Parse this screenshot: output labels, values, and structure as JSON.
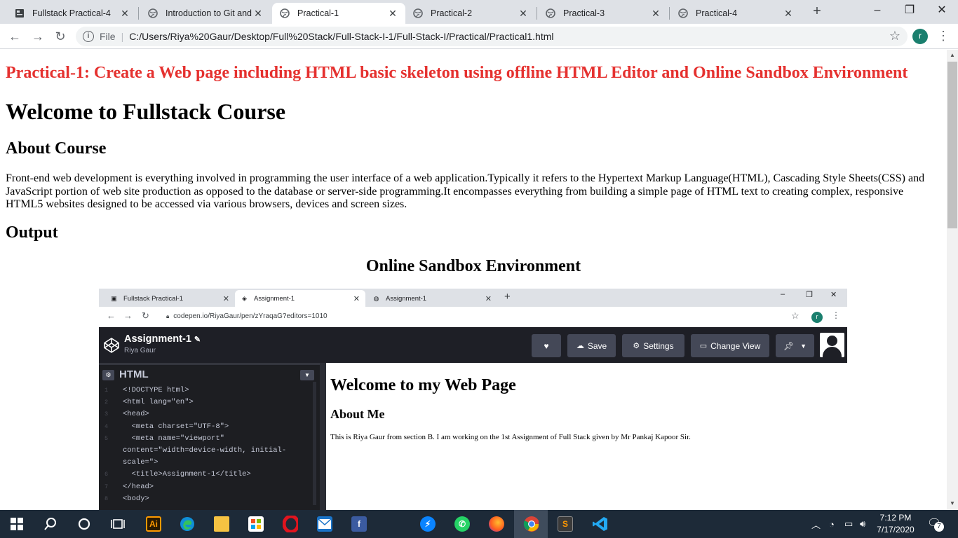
{
  "browser": {
    "tabs": [
      {
        "title": "Fullstack Practical-4",
        "icon": "page-icon"
      },
      {
        "title": "Introduction to Git and",
        "icon": "globe-icon"
      },
      {
        "title": "Practical-1",
        "icon": "globe-icon",
        "active": true
      },
      {
        "title": "Practical-2",
        "icon": "globe-icon"
      },
      {
        "title": "Practical-3",
        "icon": "globe-icon"
      },
      {
        "title": "Practical-4",
        "icon": "globe-icon"
      }
    ],
    "address": {
      "scheme_label": "File",
      "url": "C:/Users/Riya%20Gaur/Desktop/Full%20Stack/Full-Stack-I-1/Full-Stack-I/Practical/Practical1.html"
    },
    "profile_initial": "r"
  },
  "page": {
    "practical_title": "Practical-1: Create a Web page including HTML basic skeleton using offline HTML Editor and Online Sandbox Environment",
    "welcome_heading": "Welcome to Fullstack Course",
    "about_heading": "About Course",
    "about_text": "Front-end web development is everything involved in programming the user interface of a web application.Typically it refers to the Hypertext Markup Language(HTML), Cascading Style Sheets(CSS) and JavaScript portion of web site production as opposed to the database or server-side programming.It encompasses everything from building a simple page of HTML text to creating complex, responsive HTML5 websites designed to be accessed via various browsers, devices and screen sizes.",
    "output_heading": "Output",
    "sandbox_heading": "Online Sandbox Environment"
  },
  "screenshot": {
    "tabs": [
      {
        "title": "Fullstack Practical-1"
      },
      {
        "title": "Assignment-1",
        "active": true
      },
      {
        "title": "Assignment-1"
      }
    ],
    "url": "codepen.io/RiyaGaur/pen/zYraqaG?editors=1010",
    "profile_initial": "r",
    "codepen": {
      "pen_title": "Assignment-1",
      "author": "Riya Gaur",
      "buttons": {
        "save": "Save",
        "settings": "Settings",
        "change_view": "Change View"
      },
      "editor_label": "HTML",
      "code_lines": [
        {
          "n": "1",
          "text": "<!DOCTYPE html>"
        },
        {
          "n": "2",
          "text": "<html lang=\"en\">"
        },
        {
          "n": "3",
          "text": "<head>"
        },
        {
          "n": "4",
          "text": "  <meta charset=\"UTF-8\">"
        },
        {
          "n": "5",
          "text": "  <meta name=\"viewport\""
        },
        {
          "n": "",
          "text": "content=\"width=device-width, initial-"
        },
        {
          "n": "",
          "text": "scale=\">"
        },
        {
          "n": "6",
          "text": "  <title>Assignment-1</title>"
        },
        {
          "n": "7",
          "text": "</head>"
        },
        {
          "n": "8",
          "text": "<body>"
        }
      ],
      "preview": {
        "h1": "Welcome to my Web Page",
        "h2": "About Me",
        "p": "This is Riya Gaur from section B. I am working on the 1st Assignment of Full Stack given by Mr Pankaj Kapoor Sir."
      }
    }
  },
  "taskbar": {
    "time": "7:12 PM",
    "date": "7/17/2020",
    "notifications": "7"
  },
  "colors": {
    "practical_title": "#e5312f",
    "tabbar": "#dee1e6",
    "taskbar": "#1d2a38",
    "codepen_dark": "#1e1f26"
  }
}
